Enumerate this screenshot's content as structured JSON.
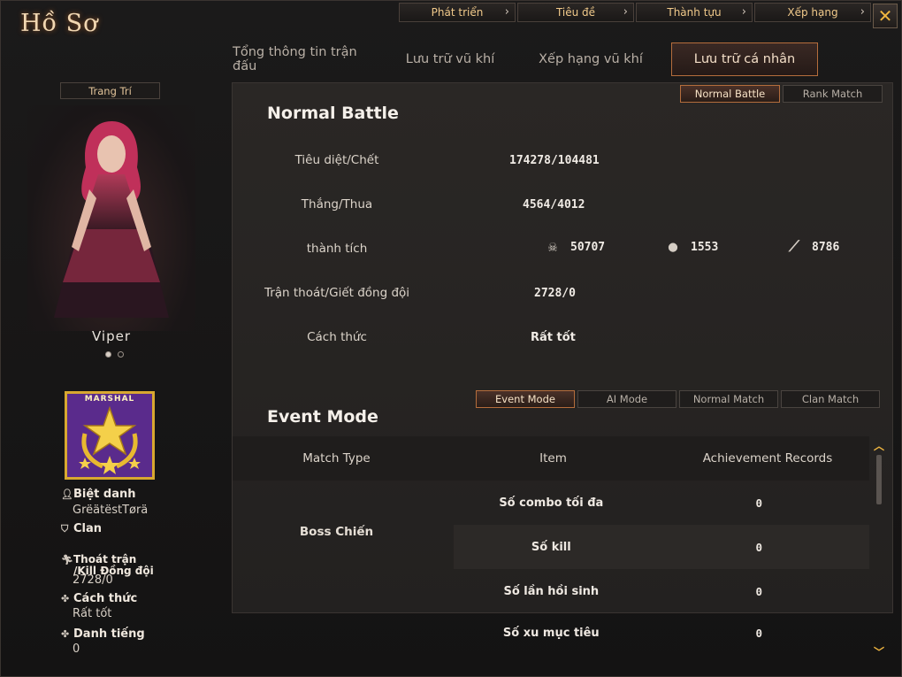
{
  "window": {
    "title": "Hồ Sơ",
    "close_label": "✕"
  },
  "topnav": [
    {
      "label": "Phát triển"
    },
    {
      "label": "Tiêu đề"
    },
    {
      "label": "Thành tựu"
    },
    {
      "label": "Xếp hạng"
    }
  ],
  "tabs": [
    {
      "label": "Tổng thông tin trận đấu"
    },
    {
      "label": "Lưu trữ vũ khí"
    },
    {
      "label": "Xếp hạng vũ khí"
    },
    {
      "label": "Lưu trữ cá nhân",
      "active": true
    }
  ],
  "profile": {
    "decor_button": "Trang Trí",
    "character_name": "Viper",
    "rank_name": "MARSHAL",
    "nickname_label": "Biệt danh",
    "nickname": "GrëätëstTørä",
    "clan_label": "Clan",
    "clan": "",
    "desert_label_1": "Thoát trận",
    "desert_label_2": "/Kill Đồng đội",
    "desert_value": "2728/0",
    "manner_label": "Cách thức",
    "manner_value": "Rất tốt",
    "reputation_label": "Danh tiếng",
    "reputation_value": "0"
  },
  "mode_buttons": [
    {
      "label": "Normal Battle",
      "active": true
    },
    {
      "label": "Rank Match"
    }
  ],
  "normal_battle": {
    "title": "Normal Battle",
    "rows": [
      {
        "label": "Tiêu diệt/Chết",
        "value": "174278/104481"
      },
      {
        "label": "Thắng/Thua",
        "value": "4564/4012"
      },
      {
        "label": "thành tích",
        "value": ""
      },
      {
        "label": "Trận thoát/Giết đồng đội",
        "value": "2728/0"
      },
      {
        "label": "Cách thức",
        "value": "Rất tốt"
      }
    ],
    "achievements": [
      {
        "icon": "skull-icon",
        "value": "50707"
      },
      {
        "icon": "grenade-icon",
        "value": "1553"
      },
      {
        "icon": "knife-icon",
        "value": "8786"
      }
    ]
  },
  "event_buttons": [
    {
      "label": "Event Mode",
      "active": true
    },
    {
      "label": "AI Mode"
    },
    {
      "label": "Normal Match"
    },
    {
      "label": "Clan Match"
    }
  ],
  "event_mode": {
    "title": "Event Mode",
    "headers": [
      "Match Type",
      "Item",
      "Achievement Records"
    ],
    "match_type": "Boss Chiến",
    "rows": [
      {
        "item": "Số combo tối đa",
        "record": "0"
      },
      {
        "item": "Số kill",
        "record": "0"
      },
      {
        "item": "Số lần hồi sinh",
        "record": "0"
      },
      {
        "item": "Số xu mục tiêu",
        "record": "0"
      }
    ]
  }
}
